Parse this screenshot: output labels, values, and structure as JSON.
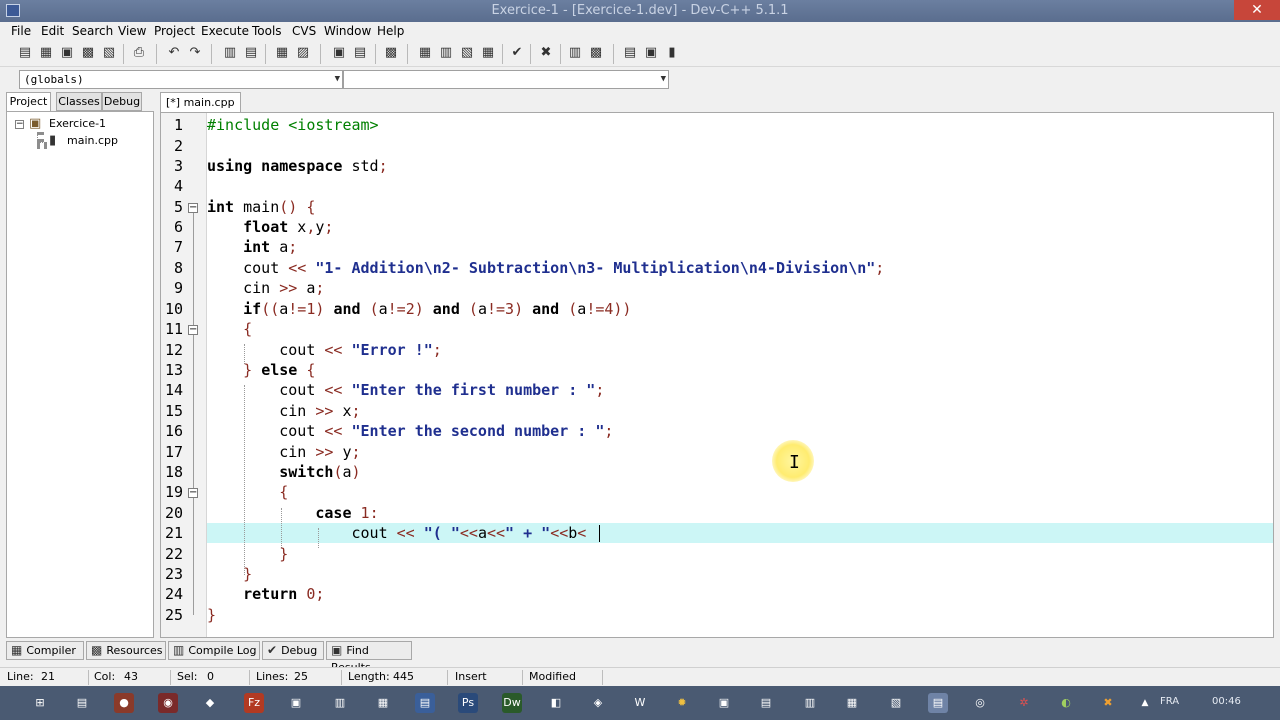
{
  "window": {
    "title": "Exercice-1 - [Exercice-1.dev] - Dev-C++ 5.1.1"
  },
  "menu": [
    "File",
    "Edit",
    "Search",
    "View",
    "Project",
    "Execute",
    "Tools",
    "CVS",
    "Window",
    "Help"
  ],
  "combos": {
    "scope": "(globals)",
    "member": ""
  },
  "left_panel": {
    "tabs": [
      "Project",
      "Classes",
      "Debug"
    ],
    "tree": {
      "project": "Exercice-1",
      "file": "main.cpp"
    }
  },
  "editor": {
    "tab": "[*] main.cpp",
    "line_numbers": [
      "1",
      "2",
      "3",
      "4",
      "5",
      "6",
      "7",
      "8",
      "9",
      "10",
      "11",
      "12",
      "13",
      "14",
      "15",
      "16",
      "17",
      "18",
      "19",
      "20",
      "21",
      "22",
      "23",
      "24",
      "25"
    ],
    "active_line": 21
  },
  "bottom_tabs": [
    "Compiler",
    "Resources",
    "Compile Log",
    "Debug",
    "Find Results"
  ],
  "status": {
    "line_label": "Line:",
    "line_value": "21",
    "col_label": "Col:",
    "col_value": "43",
    "sel_label": "Sel:",
    "sel_value": "0",
    "lines_label": "Lines:",
    "lines_value": "25",
    "length_label": "Length:",
    "length_value": "445",
    "mode": "Insert",
    "state": "Modified"
  },
  "taskbar": {
    "lang": "FRA",
    "clock": "00:46"
  },
  "colors": {
    "active_line": "#ccf6f6",
    "string": "#1f2f8f",
    "number": "#8a2b22",
    "taskbar": "#4a5a72"
  }
}
